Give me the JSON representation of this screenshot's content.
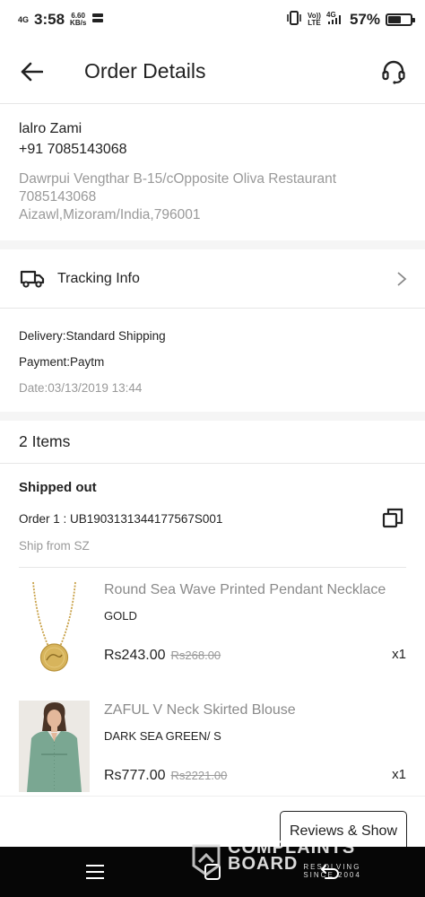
{
  "status_bar": {
    "network_type": "4G",
    "time": "3:58",
    "speed_value": "6.60",
    "speed_unit": "KB/s",
    "volte_line1": "Vo))",
    "volte_line2": "LTE",
    "signal_type": "4G",
    "battery": "57%",
    "battery_level": 0.57
  },
  "header": {
    "title": "Order Details",
    "back_icon": "arrow-left-icon",
    "support_icon": "headset-icon"
  },
  "address": {
    "name": "lalro Zami",
    "phone": "+91 7085143068",
    "line1": "Dawrpui Vengthar B-15/cOpposite Oliva Restaurant",
    "line2": "7085143068",
    "line3": "Aizawl,Mizoram/India,796001"
  },
  "tracking": {
    "label": "Tracking Info",
    "icon": "truck-icon"
  },
  "order_info": {
    "delivery": "Delivery:Standard Shipping",
    "payment": "Payment:Paytm",
    "date": "Date:03/13/2019 13:44"
  },
  "items_count": "2 Items",
  "shipment": {
    "status": "Shipped out",
    "order": "Order 1 :   UB1903131344177567S001",
    "ship_from": "Ship from SZ"
  },
  "products": [
    {
      "name": "Round Sea Wave Printed Pendant Necklace",
      "variant": "GOLD",
      "price": "Rs243.00",
      "old_price": "Rs268.00",
      "qty": "x1",
      "image": "gold-necklace-image"
    },
    {
      "name": "ZAFUL V Neck Skirted Blouse",
      "variant": "DARK SEA GREEN/ S",
      "price": "Rs777.00",
      "old_price": "Rs2221.00",
      "qty": "x1",
      "image": "green-blouse-image"
    }
  ],
  "footer": {
    "reviews_button": "Reviews & Show"
  },
  "watermark": {
    "line1": "COMPLAINTS",
    "line2": "BOARD",
    "tagline1": "RESOLVING",
    "tagline2": "SINCE 2004"
  },
  "colors": {
    "text_primary": "#222222",
    "text_secondary": "#999999",
    "divider": "#e6e6e6",
    "nav_bar": "#060606"
  }
}
